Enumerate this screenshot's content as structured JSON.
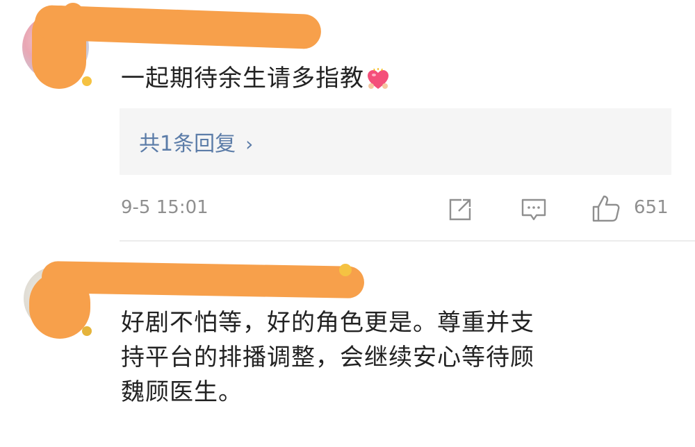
{
  "comments": [
    {
      "text": "一起期待余生请多指教",
      "emoji": "heart-with-hands-emoji",
      "reply_summary": "共1条回复",
      "reply_chevron": "›",
      "timestamp": "9-5 15:01",
      "like_count": "651"
    },
    {
      "text_lines": [
        "好剧不怕等，好的角色更是。尊重并支",
        "持平台的排播调整，会继续安心等待顾",
        "魏顾医生。"
      ]
    }
  ],
  "colors": {
    "redaction": "#f7a04b",
    "link": "#5b7ca8",
    "meta_text": "#8f8f8f",
    "reply_bg": "#f5f5f5"
  }
}
